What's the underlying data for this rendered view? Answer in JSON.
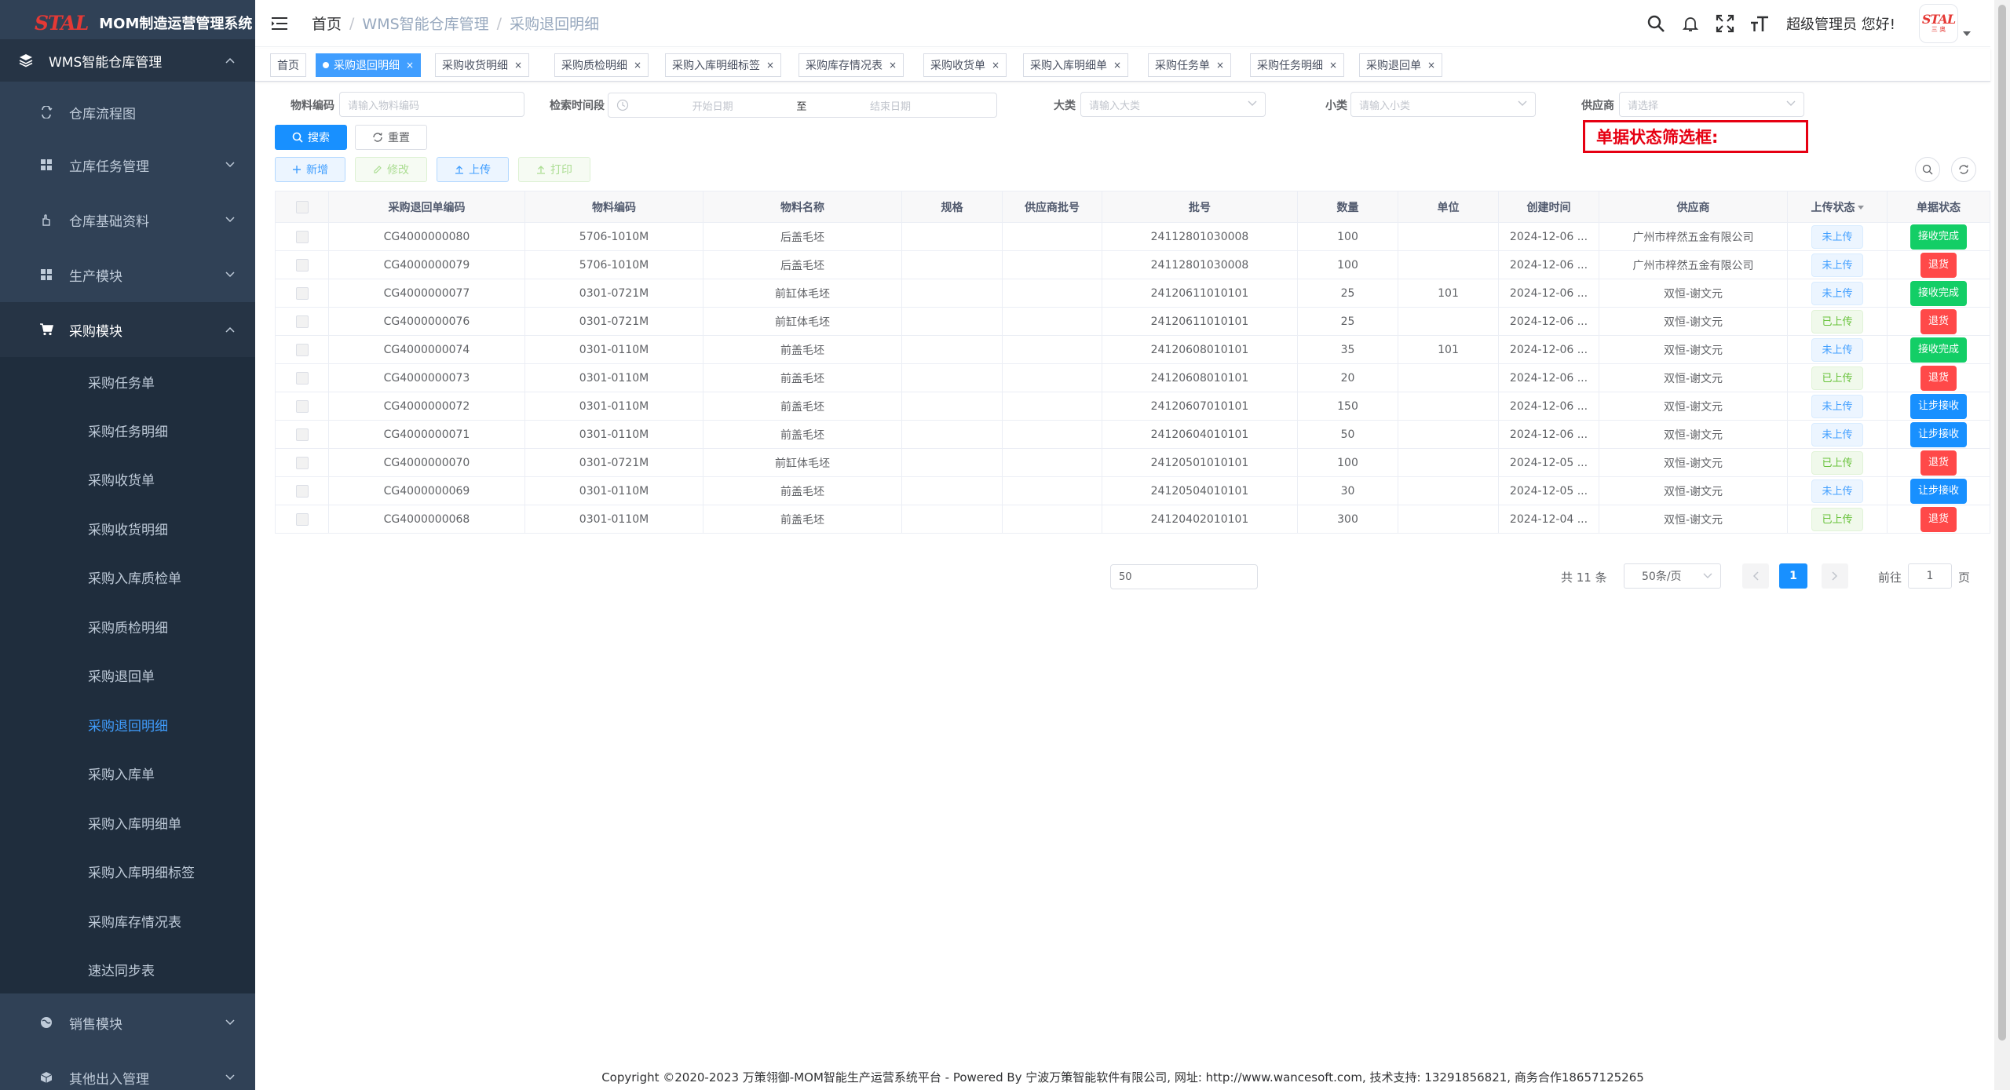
{
  "app": {
    "logo_text": "STAL",
    "title": "MOM制造运营管理系统"
  },
  "sidebar": {
    "top_item": "WMS智能仓库管理",
    "items": [
      {
        "label": "仓库流程图",
        "icon": "swap-icon"
      },
      {
        "label": "立库任务管理",
        "icon": "grid-icon"
      },
      {
        "label": "仓库基础资料",
        "icon": "hand-icon"
      },
      {
        "label": "生产模块",
        "icon": "grid-icon"
      },
      {
        "label": "采购模块",
        "icon": "cart-icon"
      },
      {
        "label": "销售模块",
        "icon": "globe-icon"
      },
      {
        "label": "其他出入管理",
        "icon": "box-icon"
      }
    ],
    "purchase_subitems": [
      "采购任务单",
      "采购任务明细",
      "采购收货单",
      "采购收货明细",
      "采购入库质检单",
      "采购质检明细",
      "采购退回单",
      "采购退回明细",
      "采购入库单",
      "采购入库明细单",
      "采购入库明细标签",
      "采购库存情况表",
      "速达同步表"
    ],
    "active_subitem": "采购退回明细"
  },
  "header": {
    "breadcrumb": [
      "首页",
      "WMS智能仓库管理",
      "采购退回明细"
    ],
    "greeting": "超级管理员 您好!",
    "avatar_text": "STAL",
    "avatar_sub": "三 奥"
  },
  "tags": [
    {
      "label": "首页",
      "closable": false,
      "active": false
    },
    {
      "label": "采购退回明细",
      "closable": true,
      "active": true
    },
    {
      "label": "采购收货明细",
      "closable": true,
      "active": false
    },
    {
      "label": "采购质检明细",
      "closable": true,
      "active": false
    },
    {
      "label": "采购入库明细标签",
      "closable": true,
      "active": false
    },
    {
      "label": "采购库存情况表",
      "closable": true,
      "active": false
    },
    {
      "label": "采购收货单",
      "closable": true,
      "active": false
    },
    {
      "label": "采购入库明细单",
      "closable": true,
      "active": false
    },
    {
      "label": "采购任务单",
      "closable": true,
      "active": false
    },
    {
      "label": "采购任务明细",
      "closable": true,
      "active": false
    },
    {
      "label": "采购退回单",
      "closable": true,
      "active": false
    }
  ],
  "filters": {
    "material_code": {
      "label": "物料编码",
      "placeholder": "请输入物料编码"
    },
    "search_time": {
      "label": "检索时间段",
      "start_placeholder": "开始日期",
      "separator": "至",
      "end_placeholder": "结束日期"
    },
    "major_class": {
      "label": "大类",
      "placeholder": "请输入大类"
    },
    "minor_class": {
      "label": "小类",
      "placeholder": "请输入小类"
    },
    "supplier": {
      "label": "供应商",
      "placeholder": "请选择"
    }
  },
  "buttons": {
    "search": "搜索",
    "reset": "重置",
    "add": "新增",
    "edit": "修改",
    "upload": "上传",
    "print": "打印"
  },
  "annotation": "单据状态筛选框:",
  "table": {
    "columns": [
      "采购退回单编码",
      "物料编码",
      "物料名称",
      "规格",
      "供应商批号",
      "批号",
      "数量",
      "单位",
      "创建时间",
      "供应商",
      "上传状态",
      "单据状态"
    ],
    "rows": [
      {
        "code": "CG4000000080",
        "material": "5706-1010M",
        "name": "后盖毛坯",
        "spec": "",
        "supplier_batch": "",
        "batch": "24112801030008",
        "qty": "100",
        "unit": "",
        "created": "2024-12-06 ...",
        "supplier": "广州市梓然五金有限公司",
        "upload": "未上传",
        "status": "接收完成"
      },
      {
        "code": "CG4000000079",
        "material": "5706-1010M",
        "name": "后盖毛坯",
        "spec": "",
        "supplier_batch": "",
        "batch": "24112801030008",
        "qty": "100",
        "unit": "",
        "created": "2024-12-06 ...",
        "supplier": "广州市梓然五金有限公司",
        "upload": "未上传",
        "status": "退货"
      },
      {
        "code": "CG4000000077",
        "material": "0301-0721M",
        "name": "前缸体毛坯",
        "spec": "",
        "supplier_batch": "",
        "batch": "24120611010101",
        "qty": "25",
        "unit": "101",
        "created": "2024-12-06 ...",
        "supplier": "双恒-谢文元",
        "upload": "未上传",
        "status": "接收完成"
      },
      {
        "code": "CG4000000076",
        "material": "0301-0721M",
        "name": "前缸体毛坯",
        "spec": "",
        "supplier_batch": "",
        "batch": "24120611010101",
        "qty": "25",
        "unit": "",
        "created": "2024-12-06 ...",
        "supplier": "双恒-谢文元",
        "upload": "已上传",
        "status": "退货"
      },
      {
        "code": "CG4000000074",
        "material": "0301-0110M",
        "name": "前盖毛坯",
        "spec": "",
        "supplier_batch": "",
        "batch": "24120608010101",
        "qty": "35",
        "unit": "101",
        "created": "2024-12-06 ...",
        "supplier": "双恒-谢文元",
        "upload": "未上传",
        "status": "接收完成"
      },
      {
        "code": "CG4000000073",
        "material": "0301-0110M",
        "name": "前盖毛坯",
        "spec": "",
        "supplier_batch": "",
        "batch": "24120608010101",
        "qty": "20",
        "unit": "",
        "created": "2024-12-06 ...",
        "supplier": "双恒-谢文元",
        "upload": "已上传",
        "status": "退货"
      },
      {
        "code": "CG4000000072",
        "material": "0301-0110M",
        "name": "前盖毛坯",
        "spec": "",
        "supplier_batch": "",
        "batch": "24120607010101",
        "qty": "150",
        "unit": "",
        "created": "2024-12-06 ...",
        "supplier": "双恒-谢文元",
        "upload": "未上传",
        "status": "让步接收"
      },
      {
        "code": "CG4000000071",
        "material": "0301-0110M",
        "name": "前盖毛坯",
        "spec": "",
        "supplier_batch": "",
        "batch": "24120604010101",
        "qty": "50",
        "unit": "",
        "created": "2024-12-06 ...",
        "supplier": "双恒-谢文元",
        "upload": "未上传",
        "status": "让步接收"
      },
      {
        "code": "CG4000000070",
        "material": "0301-0721M",
        "name": "前缸体毛坯",
        "spec": "",
        "supplier_batch": "",
        "batch": "24120501010101",
        "qty": "100",
        "unit": "",
        "created": "2024-12-05 ...",
        "supplier": "双恒-谢文元",
        "upload": "已上传",
        "status": "退货"
      },
      {
        "code": "CG4000000069",
        "material": "0301-0110M",
        "name": "前盖毛坯",
        "spec": "",
        "supplier_batch": "",
        "batch": "24120504010101",
        "qty": "30",
        "unit": "",
        "created": "2024-12-05 ...",
        "supplier": "双恒-谢文元",
        "upload": "未上传",
        "status": "让步接收"
      },
      {
        "code": "CG4000000068",
        "material": "0301-0110M",
        "name": "前盖毛坯",
        "spec": "",
        "supplier_batch": "",
        "batch": "24120402010101",
        "qty": "300",
        "unit": "",
        "created": "2024-12-04 ...",
        "supplier": "双恒-谢文元",
        "upload": "已上传",
        "status": "退货"
      }
    ]
  },
  "status_colors": {
    "接收完成": "#13ce66",
    "退货": "#ff4949",
    "让步接收": "#1890ff"
  },
  "pagination": {
    "page_size_input": "50",
    "total": "共 11 条",
    "page_size": "50条/页",
    "current_page": "1",
    "goto_prefix": "前往",
    "goto_value": "1",
    "goto_suffix": "页"
  },
  "footer": "Copyright ©2020-2023 万策翎御-MOM智能生产运营系统平台 - Powered By 宁波万策智能软件有限公司, 网址: http://www.wancesoft.com, 技术支持: 13291856821, 商务合作18657125265",
  "colors": {
    "sidebar_bg": "#304156",
    "accent": "#409eff",
    "primary": "#1890ff",
    "annotation": "#e60012"
  }
}
